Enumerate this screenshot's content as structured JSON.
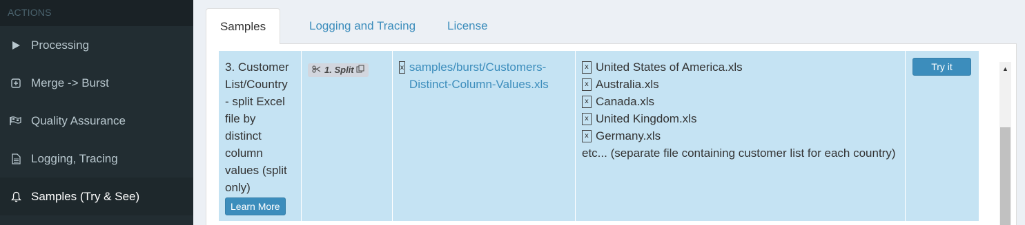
{
  "sidebar": {
    "header": "ACTIONS",
    "items": [
      {
        "label": "Processing",
        "icon": "play-icon"
      },
      {
        "label": "Merge -> Burst",
        "icon": "plus-square-icon"
      },
      {
        "label": "Quality Assurance",
        "icon": "flag-checkered-icon"
      },
      {
        "label": "Logging, Tracing",
        "icon": "file-text-icon"
      },
      {
        "label": "Samples (Try & See)",
        "icon": "bell-icon"
      }
    ]
  },
  "tabs": [
    {
      "label": "Samples"
    },
    {
      "label": "Logging and Tracing"
    },
    {
      "label": "License"
    }
  ],
  "sample": {
    "description": "3. Customer List/Country - split Excel file by distinct column values (split only)",
    "learn_more": "Learn More",
    "step_badge": "1. Split",
    "input_file": "samples/burst/Customers-Distinct-Column-Values.xls",
    "outputs": [
      "United States of America.xls",
      "Australia.xls",
      "Canada.xls",
      "United Kingdom.xls",
      "Germany.xls"
    ],
    "outputs_note": "etc... (separate file containing customer list for each country)",
    "try_it": "Try it"
  },
  "colors": {
    "sidebar_bg": "#222d32",
    "accent": "#3c8dbc",
    "row_bg": "#c5e3f3"
  }
}
